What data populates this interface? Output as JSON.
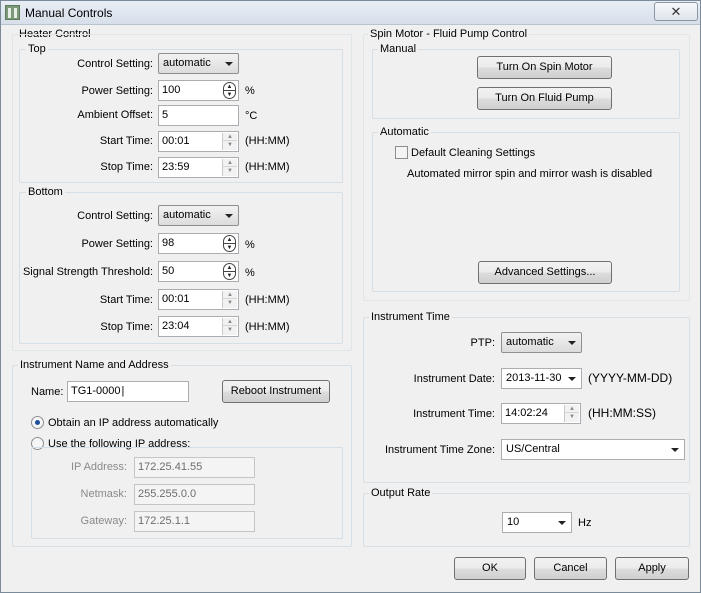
{
  "window": {
    "title": "Manual Controls",
    "close_glyph": "✕",
    "icon": "app-icon"
  },
  "heater": {
    "title": "Heater Control",
    "top": {
      "title": "Top",
      "control_setting_label": "Control Setting:",
      "control_setting_value": "automatic",
      "power_label": "Power Setting:",
      "power_value": "100",
      "power_unit": "%",
      "ambient_label": "Ambient Offset:",
      "ambient_value": "5",
      "ambient_unit": "°C",
      "start_label": "Start Time:",
      "start_value": "00:01",
      "start_unit": "(HH:MM)",
      "stop_label": "Stop Time:",
      "stop_value": "23:59",
      "stop_unit": "(HH:MM)"
    },
    "bottom": {
      "title": "Bottom",
      "control_setting_label": "Control Setting:",
      "control_setting_value": "automatic",
      "power_label": "Power Setting:",
      "power_value": "98",
      "power_unit": "%",
      "signal_label": "Signal Strength Threshold:",
      "signal_value": "50",
      "signal_unit": "%",
      "start_label": "Start Time:",
      "start_value": "00:01",
      "start_unit": "(HH:MM)",
      "stop_label": "Stop Time:",
      "stop_value": "23:04",
      "stop_unit": "(HH:MM)"
    }
  },
  "instrument": {
    "title": "Instrument Name and Address",
    "name_label": "Name:",
    "name_value": "TG1-0000",
    "reboot_label": "Reboot Instrument",
    "obtain_auto_label": "Obtain an IP address automatically",
    "use_following_label": "Use the following IP address:",
    "ip_label": "IP Address:",
    "ip_value": "172.25.41.55",
    "netmask_label": "Netmask:",
    "netmask_value": "255.255.0.0",
    "gateway_label": "Gateway:",
    "gateway_value": "172.25.1.1"
  },
  "spin_pump": {
    "title": "Spin Motor - Fluid Pump Control",
    "manual_title": "Manual",
    "spin_button": "Turn On Spin Motor",
    "pump_button": "Turn On Fluid Pump",
    "automatic_title": "Automatic",
    "default_cleaning_label": "Default Cleaning Settings",
    "status_text": "Automated mirror spin and mirror wash is disabled",
    "advanced_button": "Advanced Settings..."
  },
  "instrument_time": {
    "title": "Instrument Time",
    "ptp_label": "PTP:",
    "ptp_value": "automatic",
    "date_label": "Instrument Date:",
    "date_value": "2013-11-30",
    "date_format": "(YYYY-MM-DD)",
    "time_label": "Instrument Time:",
    "time_value": "14:02:24",
    "time_format": "(HH:MM:SS)",
    "zone_label": "Instrument Time Zone:",
    "zone_value": "US/Central"
  },
  "output_rate": {
    "title": "Output Rate",
    "value": "10",
    "unit": "Hz"
  },
  "footer": {
    "ok": "OK",
    "cancel": "Cancel",
    "apply": "Apply"
  }
}
